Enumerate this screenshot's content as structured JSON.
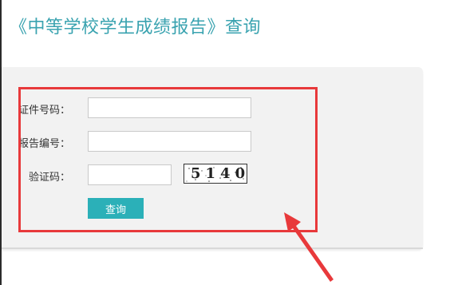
{
  "page": {
    "title": "《中等学校学生成绩报告》查询"
  },
  "form": {
    "id_number": {
      "label": "证件号码：",
      "value": "",
      "placeholder": ""
    },
    "report_number": {
      "label": "报告编号：",
      "value": "",
      "placeholder": ""
    },
    "captcha": {
      "label": "验证码：",
      "value": "",
      "placeholder": "",
      "image_text": "5140"
    },
    "submit_label": "查询"
  },
  "colors": {
    "title": "#3aa3b0",
    "button": "#2bb0b8",
    "highlight": "#e8393b",
    "panel": "#f2f2f2"
  }
}
